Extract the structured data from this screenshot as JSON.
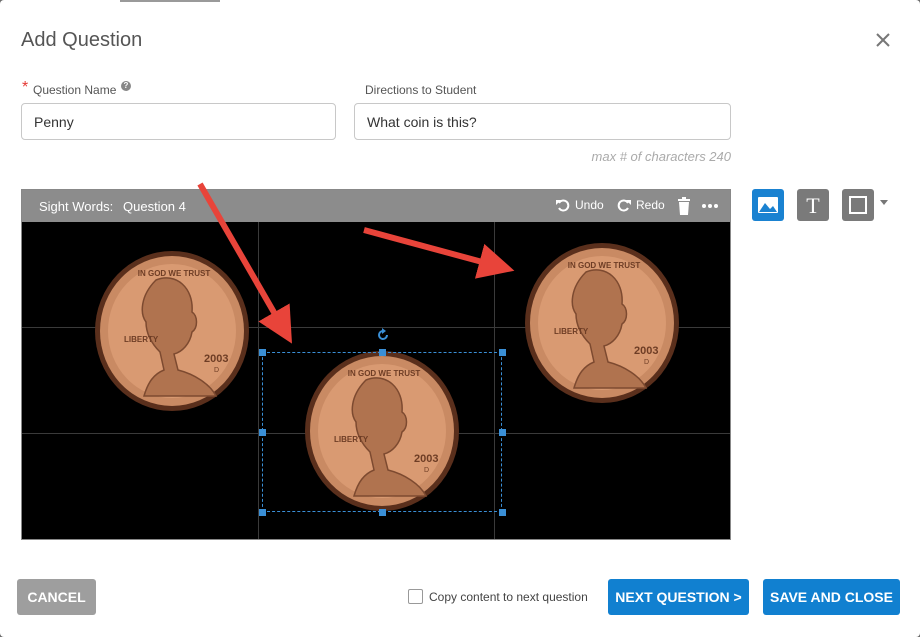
{
  "modal": {
    "title": "Add Question"
  },
  "form": {
    "question_name": {
      "label": "Question Name",
      "value": "Penny"
    },
    "directions": {
      "label": "Directions to Student",
      "value": "What coin is this?",
      "hint": "max # of characters 240"
    }
  },
  "editor": {
    "title": "Sight Words:",
    "question": "Question 4",
    "undo_label": "Undo",
    "redo_label": "Redo",
    "coin_text": {
      "top": "IN GOD WE TRUST",
      "left": "LIBERTY",
      "year": "2003",
      "mint": "D"
    }
  },
  "tools": {
    "image": "image-icon",
    "text": "text-icon",
    "shape": "square-icon"
  },
  "footer": {
    "cancel_label": "CANCEL",
    "copy_label": "Copy content to next question",
    "next_label": "NEXT QUESTION >",
    "save_label": "SAVE AND CLOSE"
  },
  "colors": {
    "primary": "#1180d0",
    "cancel": "#9e9e9e",
    "editor_bar": "#8c8c8c",
    "arrow": "#e8443a",
    "selection": "#3a8fd6",
    "required": "#e53935"
  }
}
